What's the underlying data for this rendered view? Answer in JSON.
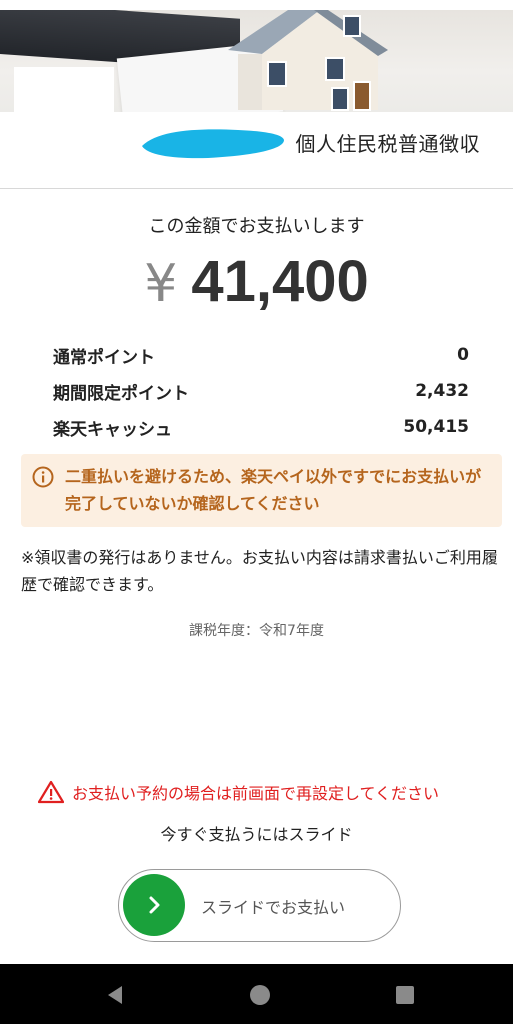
{
  "header": {
    "title": "個人住民税普通徴収"
  },
  "payment": {
    "heading": "この金額でお支払いします",
    "currency_symbol": "¥",
    "amount": "41,400"
  },
  "points": [
    {
      "label": "通常ポイント",
      "value": "0"
    },
    {
      "label": "期間限定ポイント",
      "value": "2,432"
    },
    {
      "label": "楽天キャッシュ",
      "value": "50,415"
    }
  ],
  "notice": {
    "icon": "info-icon",
    "text": "二重払いを避けるため、楽天ペイ以外ですでにお支払いが完了していないか確認してください"
  },
  "receipt_note": "※領収書の発行はありません。お支払い内容は請求書払いご利用履歴で確認できます。",
  "tax_year": "課税年度：令和7年度",
  "warning": {
    "icon": "warning-triangle-icon",
    "text": "お支払い予約の場合は前画面で再設定してください"
  },
  "slide_hint": "今すぐ支払うにはスライド",
  "slider": {
    "label": "スライドでお支払い",
    "icon": "chevron-right-icon"
  },
  "navbar": {
    "icons": [
      "back-icon",
      "home-icon",
      "recents-icon"
    ]
  },
  "colors": {
    "accent_green": "#1aa13b",
    "warning_red": "#e02020",
    "notice_bg": "#fcefe1",
    "notice_text": "#b5651d"
  }
}
